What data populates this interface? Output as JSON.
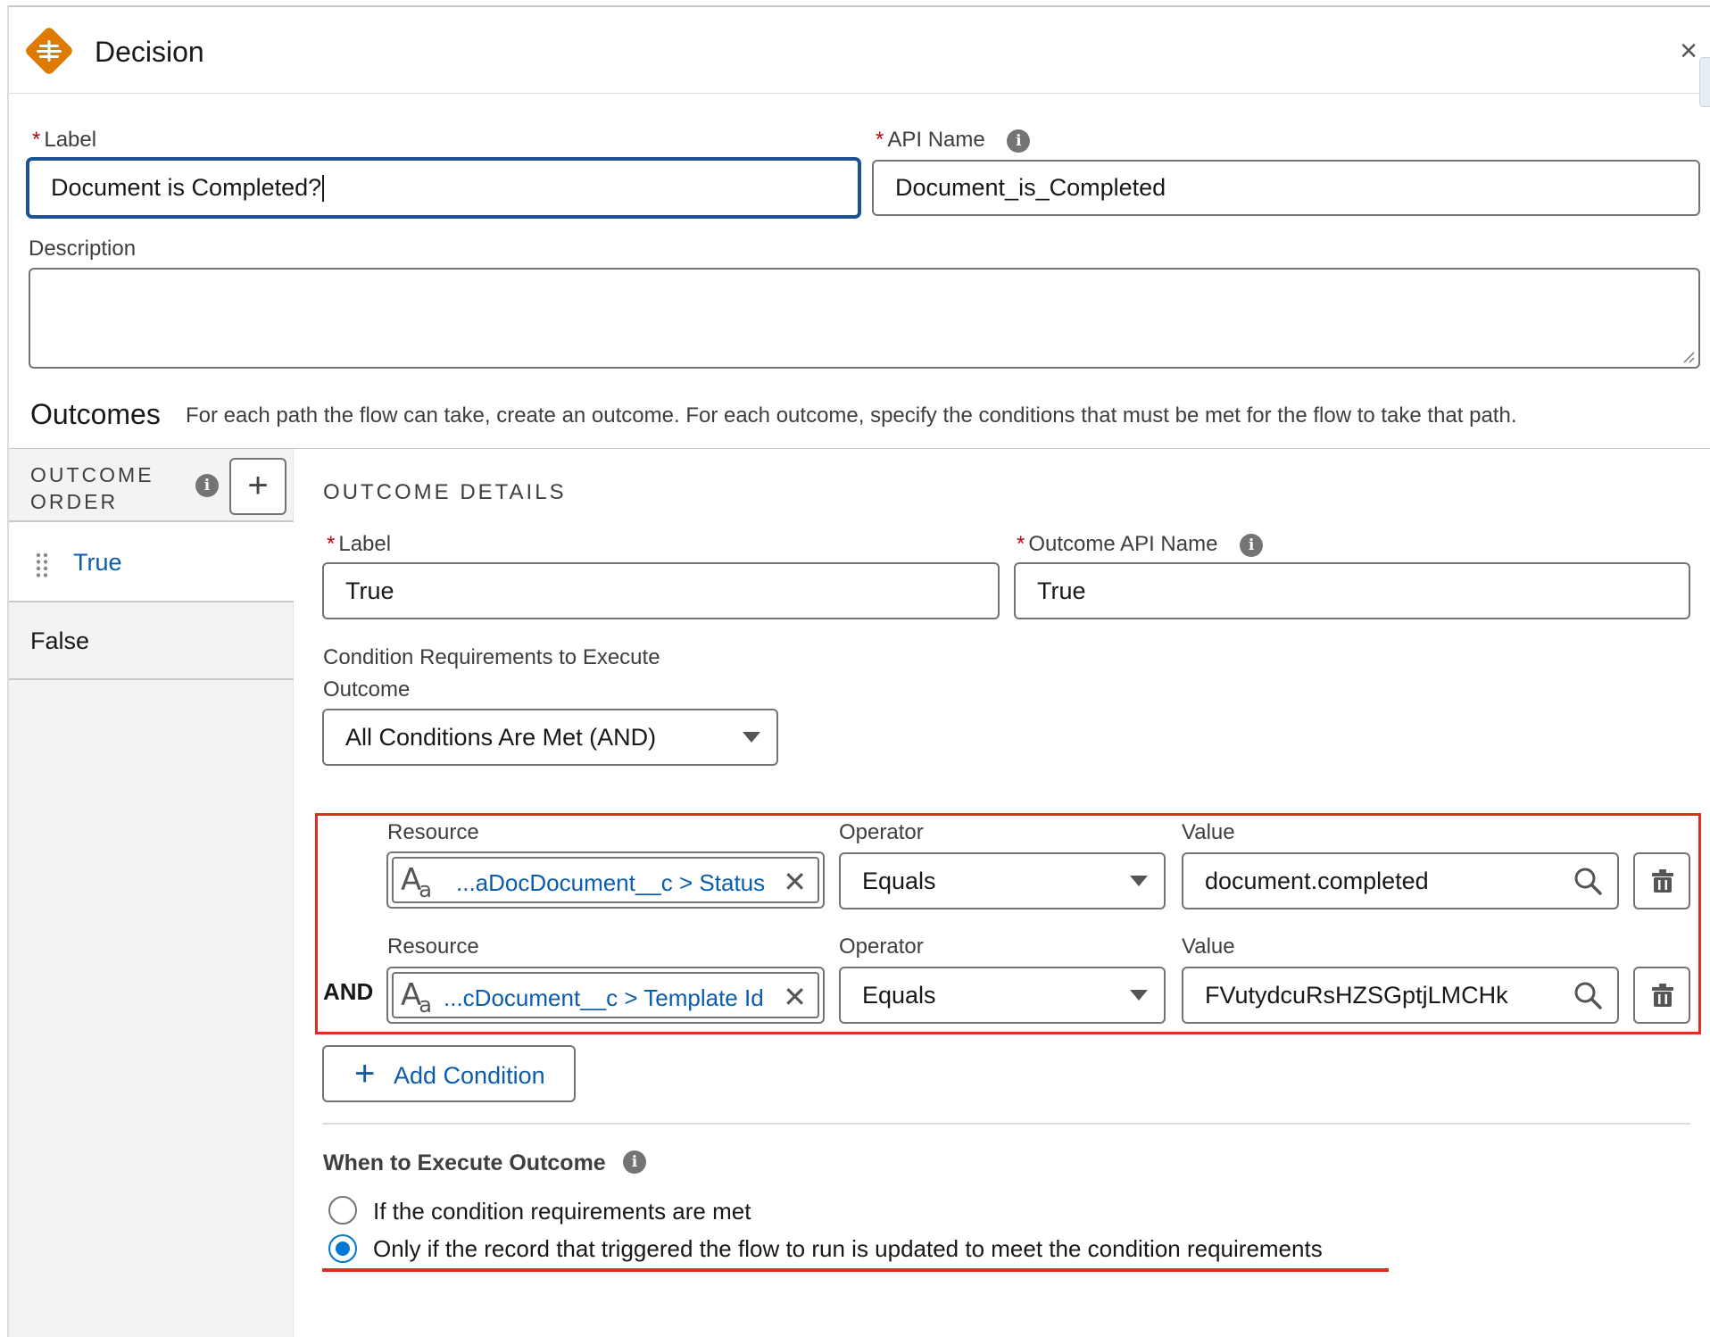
{
  "header": {
    "title": "Decision",
    "close_glyph": "×",
    "icon": "decision-icon"
  },
  "label_field": {
    "label": "Label",
    "required": "*",
    "value": "Document is Completed?"
  },
  "api_name_field": {
    "label": "API Name",
    "required": "*",
    "value": "Document_is_Completed"
  },
  "description_field": {
    "label": "Description",
    "value": ""
  },
  "outcomes": {
    "title": "Outcomes",
    "description": "For each path the flow can take, create an outcome. For each outcome, specify the conditions that must be met for the flow to take that path."
  },
  "outcome_order": {
    "title": "OUTCOME ORDER",
    "add_glyph": "+",
    "items": [
      {
        "label": "True",
        "selected": true
      },
      {
        "label": "False",
        "selected": false
      }
    ]
  },
  "outcome_details": {
    "title": "OUTCOME DETAILS",
    "label_field": {
      "label": "Label",
      "required": "*",
      "value": "True"
    },
    "api_name_field": {
      "label": "Outcome API Name",
      "required": "*",
      "value": "True"
    },
    "condition_requirements": {
      "label_line1": "Condition Requirements to Execute",
      "label_line2": "Outcome",
      "value": "All Conditions Are Met (AND)"
    },
    "conditions": [
      {
        "resource_label": "Resource",
        "resource_value": "...aDocDocument__c > Status",
        "operator_label": "Operator",
        "operator_value": "Equals",
        "value_label": "Value",
        "value": "document.completed",
        "connector": ""
      },
      {
        "resource_label": "Resource",
        "resource_value": "...cDocument__c > Template Id",
        "operator_label": "Operator",
        "operator_value": "Equals",
        "value_label": "Value",
        "value": "FVutydcuRsHZSGptjLMCHk",
        "connector": "AND"
      }
    ],
    "add_condition_label": "Add Condition",
    "when_to_execute": {
      "title": "When to Execute Outcome",
      "options": [
        {
          "label": "If the condition requirements are met",
          "checked": false
        },
        {
          "label": "Only if the record that triggered the flow to run is updated to meet the condition requirements",
          "checked": true
        }
      ]
    }
  },
  "colors": {
    "accent_blue": "#0b5cab",
    "radio_blue": "#0176d3",
    "highlight_red": "#e02d20",
    "decision_orange": "#dd7a01"
  },
  "annotations": {
    "pill_icon": "Aa",
    "pill_icon_small": "a"
  }
}
